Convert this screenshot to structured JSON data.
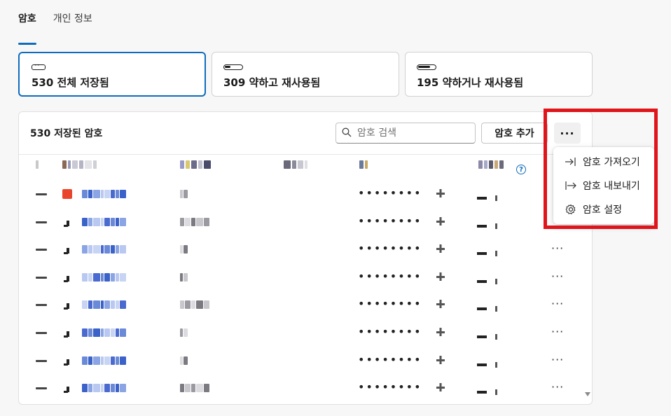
{
  "tabs": [
    {
      "label": "암호",
      "active": true
    },
    {
      "label": "개인 정보",
      "active": false
    }
  ],
  "cards": [
    {
      "label": "530 전체 저장됨",
      "icon": "password-icon",
      "selected": true
    },
    {
      "label": "309 약하고 재사용됨",
      "icon": "weak-strength-icon",
      "selected": false
    },
    {
      "label": "195 약하거나 재사용됨",
      "icon": "medium-strength-icon",
      "selected": false
    }
  ],
  "panel": {
    "title": "530 저장된 암호",
    "search_placeholder": "암호 검색",
    "add_label": "암호 추가",
    "more_label": "···",
    "help_label": "?"
  },
  "rows": [
    {
      "password": "••••••••",
      "more": ""
    },
    {
      "password": "••••••••",
      "more": ""
    },
    {
      "password": "••••••••",
      "more": "···"
    },
    {
      "password": "••••••••",
      "more": "···"
    },
    {
      "password": "••••••••",
      "more": "···"
    },
    {
      "password": "••••••••",
      "more": "···"
    },
    {
      "password": "••••••••",
      "more": "···"
    },
    {
      "password": "••••••••",
      "more": "···"
    }
  ],
  "menu": {
    "items": [
      {
        "label": "암호 가져오기",
        "icon": "import-icon"
      },
      {
        "label": "암호 내보내기",
        "icon": "export-icon"
      },
      {
        "label": "암호 설정",
        "icon": "gear-icon"
      }
    ]
  },
  "colors": {
    "accent": "#0f6cbd",
    "highlight": "#e0141b"
  }
}
